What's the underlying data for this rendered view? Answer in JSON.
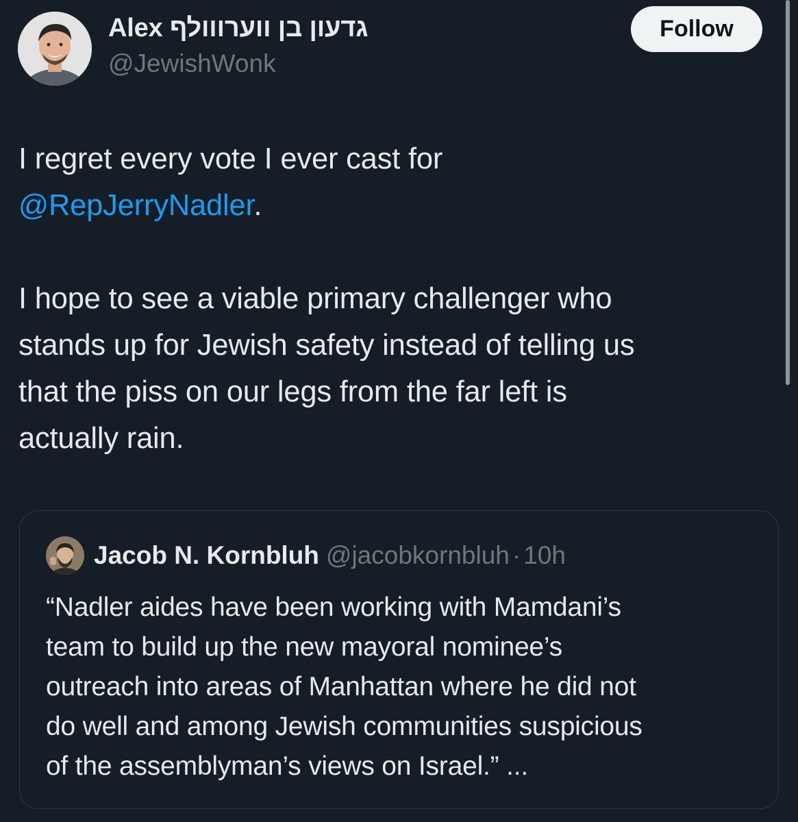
{
  "author": {
    "display_name": "Alex גדעון בן ווערווולף",
    "handle": "@JewishWonk"
  },
  "follow_label": "Follow",
  "tweet": {
    "line1": "I regret every vote I ever cast for",
    "mention": "@RepJerryNadler",
    "mention_suffix": ".",
    "paragraph2": [
      "I hope to see a viable primary challenger who",
      "stands up for Jewish safety instead of telling us",
      "that the piss on our legs from the far left is",
      "actually rain."
    ]
  },
  "quote": {
    "name": "Jacob N. Kornbluh",
    "handle": "@jacobkornbluh",
    "separator": "·",
    "time": "10h",
    "lines": [
      "“Nadler aides have been working with Mamdani’s",
      "team to build up the new mayoral nominee’s",
      "outreach into areas of Manhattan where he did not",
      "do well and among Jewish communities suspicious",
      "of the assemblyman’s views on Israel.” ..."
    ]
  },
  "icons": {
    "author_avatar": "profile-photo",
    "quote_avatar": "profile-photo"
  },
  "colors": {
    "background": "#151d27",
    "text": "#e7e9ea",
    "secondary_text": "#71767b",
    "link": "#1d9bf0",
    "follow_button_bg": "#eff3f4",
    "border": "#2f3640"
  }
}
